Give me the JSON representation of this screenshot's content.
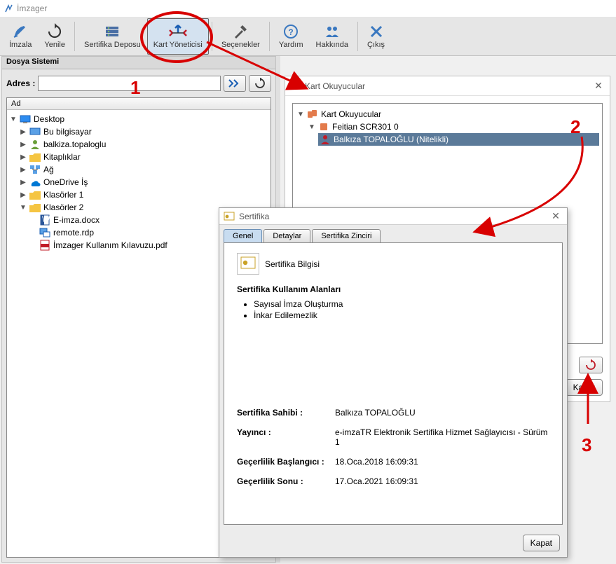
{
  "app": {
    "title": "İmzager"
  },
  "toolbar": {
    "sign": "İmzala",
    "refresh": "Yenile",
    "certstore": "Sertifika Deposu",
    "cardmgr": "Kart Yöneticisi",
    "options": "Seçenekler",
    "help": "Yardım",
    "about": "Hakkında",
    "exit": "Çıkış"
  },
  "fs": {
    "panel_title": "Dosya Sistemi",
    "addr_label": "Adres :",
    "addr_value": "",
    "tree_header": "Ad",
    "nodes": {
      "desktop": "Desktop",
      "thispc": "Bu bilgisayar",
      "user": "balkiza.topaloglu",
      "libraries": "Kitaplıklar",
      "network": "Ağ",
      "onedrive": "OneDrive İş",
      "folder1": "Klasörler 1",
      "folder2": "Klasörler 2",
      "file1": "E-imza.docx",
      "file2": "remote.rdp",
      "file3": "İmzager Kullanım Kılavuzu.pdf"
    }
  },
  "readers": {
    "title": "Kart Okuyucular",
    "root": "Kart Okuyucular",
    "reader": "Feitian SCR301 0",
    "cert": "Balkıza TOPALOĞLU (Nitelikli)",
    "close_btn": "Kapat"
  },
  "cert": {
    "title": "Sertifika",
    "tabs": {
      "general": "Genel",
      "details": "Detaylar",
      "chain": "Sertifika Zinciri"
    },
    "info_label": "Sertifika Bilgisi",
    "usage_header": "Sertifika Kullanım Alanları",
    "usage": [
      "Sayısal İmza Oluşturma",
      "İnkar Edilemezlik"
    ],
    "owner_k": "Sertifika Sahibi :",
    "owner_v": "Balkıza TOPALOĞLU",
    "issuer_k": "Yayıncı :",
    "issuer_v": "e-imzaTR Elektronik Sertifika Hizmet Sağlayıcısı - Sürüm 1",
    "start_k": "Geçerlilik Başlangıcı :",
    "start_v": "18.Oca.2018 16:09:31",
    "end_k": "Geçerlilik Sonu :",
    "end_v": "17.Oca.2021 16:09:31",
    "close_btn": "Kapat"
  },
  "annot": {
    "n1": "1",
    "n2": "2",
    "n3": "3"
  }
}
